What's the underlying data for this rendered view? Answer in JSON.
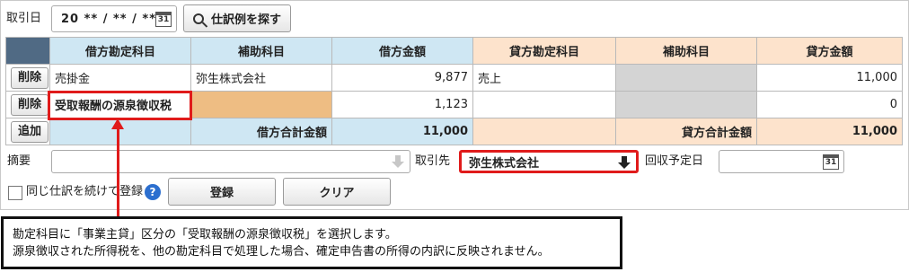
{
  "header": {
    "date_label": "取引日",
    "date_value": "20 ** / ** / **",
    "calendar_day": "31",
    "search_button": "仕訳例を探す"
  },
  "table": {
    "columns": [
      "借方勘定科目",
      "補助科目",
      "借方金額",
      "貸方勘定科目",
      "補助科目",
      "貸方金額"
    ],
    "rows": [
      {
        "action": "削除",
        "debit_account": "売掛金",
        "debit_sub": "弥生株式会社",
        "debit_amount": "9,877",
        "credit_account": "売上",
        "credit_sub": "",
        "credit_amount": "11,000"
      },
      {
        "action": "削除",
        "debit_account": "受取報酬の源泉徴収税",
        "debit_sub": "",
        "debit_amount": "1,123",
        "credit_account": "",
        "credit_sub": "",
        "credit_amount": "0"
      }
    ],
    "add_button": "追加",
    "debit_total_label": "借方合計金額",
    "debit_total": "11,000",
    "credit_total_label": "貸方合計金額",
    "credit_total": "11,000"
  },
  "form": {
    "memo_label": "摘要",
    "memo_value": "",
    "partner_label": "取引先",
    "partner_value": "弥生株式会社",
    "due_label": "回収予定日",
    "due_value": "",
    "repeat_label": "同じ仕訳を続けて登録",
    "help_icon": "?",
    "register_button": "登録",
    "clear_button": "クリア"
  },
  "annotation": {
    "line1": "勘定科目に「事業主貸」区分の「受取報酬の源泉徴収税」を選択します。",
    "line2": "源泉徴収された所得税を、他の勘定科目で処理した場合、確定申告書の所得の内訳に反映されません。",
    "highlight_color": "#e01b1b"
  }
}
